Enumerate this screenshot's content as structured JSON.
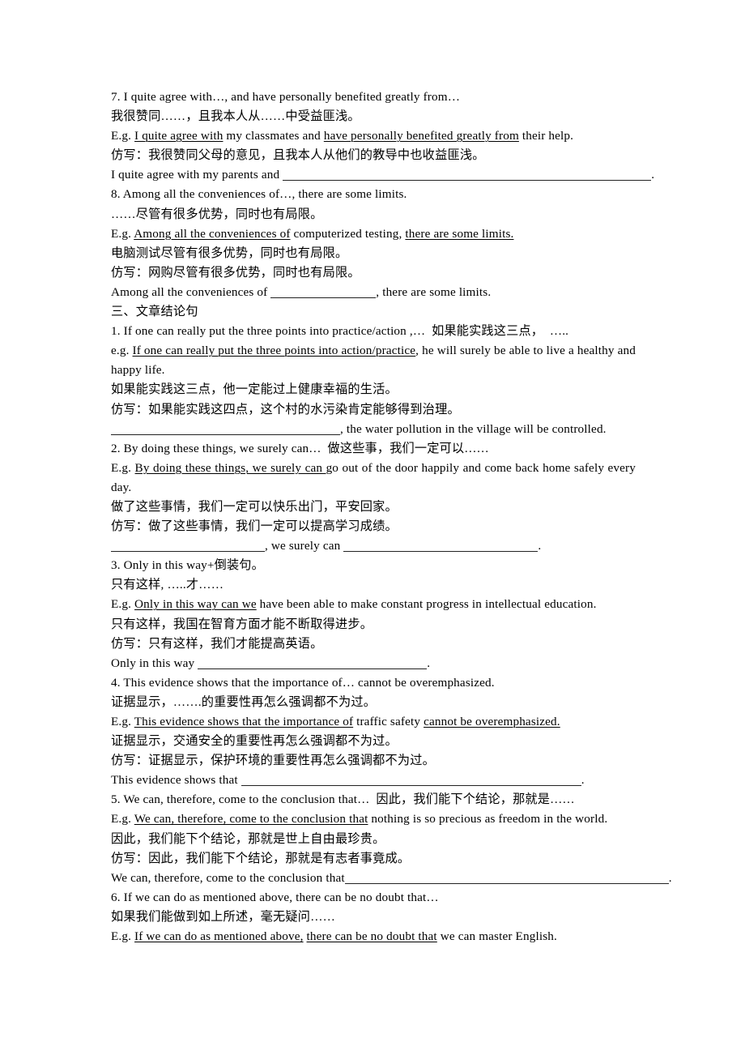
{
  "document": {
    "language": "zh-en",
    "section_heading": "三、文章结论句",
    "lines": {
      "i7_en": "7. I quite agree with…, and have personally benefited greatly from…",
      "i7_cn": "我很赞同……，且我本人从……中受益匪浅。",
      "i7_eg_prefix": "E.g. ",
      "i7_eg_u1": "I quite agree with",
      "i7_eg_mid": " my classmates and ",
      "i7_eg_u2": "have personally benefited greatly from",
      "i7_eg_tail": " their help.",
      "i7_fang": "仿写：我很赞同父母的意见，且我本人从他们的教导中也收益匪浅。",
      "i7_blank_lead": "I quite agree with my parents and ",
      "i7_blank_tail": ".",
      "i8_en": "8. Among all the conveniences of…, there are some limits.",
      "i8_cn": "……尽管有很多优势，同时也有局限。",
      "i8_eg_prefix": "E.g. ",
      "i8_eg_u1": "Among all the conveniences of",
      "i8_eg_mid": " computerized testing, ",
      "i8_eg_u2": "there are some limits.",
      "i8_cn2": "电脑测试尽管有很多优势，同时也有局限。",
      "i8_fang": "仿写：网购尽管有很多优势，同时也有局限。",
      "i8_blank_lead": "Among all the conveniences of ",
      "i8_blank_tail": ", there are some limits.",
      "c1_en": "1. If one can really put the three points into practice/action ,…  如果能实践这三点，　…..",
      "c1_eg_prefix": "e.g. ",
      "c1_eg_u1": "If one can really put the three points into action/practice",
      "c1_eg_tail": ", he will surely be able to live a healthy and happy life.",
      "c1_cn": "如果能实践这三点，他一定能过上健康幸福的生活。",
      "c1_fang": "仿写：如果能实践这四点，这个村的水污染肯定能够得到治理。",
      "c1_blank_tail": ", the water pollution in the village will be controlled.",
      "c2_en": "2. By doing these things, we surely can…  做这些事，我们一定可以……",
      "c2_eg_prefix": "E.g. ",
      "c2_eg_u1": "By doing these things, we surely can ",
      "c2_eg_tail": "go out of the door happily and come back home safely every day.",
      "c2_cn": "做了这些事情，我们一定可以快乐出门，平安回家。",
      "c2_fang": "仿写：做了这些事情，我们一定可以提高学习成绩。",
      "c2_blank_mid": ", we surely can ",
      "c2_blank_tail": ".",
      "c3_en": "3. Only in this way+倒装句。",
      "c3_cn": "只有这样, …..才……",
      "c3_eg_prefix": "E.g. ",
      "c3_eg_u1": "Only in this way can we",
      "c3_eg_tail": " have been able to make constant progress in intellectual education.",
      "c3_cn2": "只有这样，我国在智育方面才能不断取得进步。",
      "c3_fang": "仿写：只有这样，我们才能提高英语。",
      "c3_blank_lead": "Only in this way ",
      "c3_blank_tail": ".",
      "c4_en": "4. This evidence shows that the importance of… cannot be overemphasized.",
      "c4_cn": "证据显示，…….的重要性再怎么强调都不为过。",
      "c4_eg_prefix": "E.g. ",
      "c4_eg_u1": "This evidence shows that the importance of",
      "c4_eg_mid": " traffic safety ",
      "c4_eg_u2": "cannot be overemphasized.",
      "c4_cn2": "证据显示，交通安全的重要性再怎么强调都不为过。",
      "c4_fang": "仿写：证据显示，保护环境的重要性再怎么强调都不为过。",
      "c4_blank_lead": "This evidence shows that ",
      "c4_blank_tail": ".",
      "c5_en": "5. We can, therefore, come to the conclusion that…  因此，我们能下个结论，那就是……",
      "c5_eg_prefix": "E.g. ",
      "c5_eg_u1": "We can, therefore, come to the conclusion that",
      "c5_eg_tail": " nothing is so precious as freedom in the world.",
      "c5_cn": "因此，我们能下个结论，那就是世上自由最珍贵。",
      "c5_fang": "仿写：因此，我们能下个结论，那就是有志者事竟成。",
      "c5_blank_lead": "We can, therefore, come to the conclusion that",
      "c5_blank_tail": ".",
      "c6_en": "6. If we can do as mentioned above, there can be no doubt that…",
      "c6_cn": "如果我们能做到如上所述，毫无疑问……",
      "c6_eg_prefix": "E.g. ",
      "c6_eg_u1": "If we can do as mentioned above,",
      "c6_eg_mid": " ",
      "c6_eg_u2": "there can be no doubt that",
      "c6_eg_tail": " we can master English."
    }
  }
}
